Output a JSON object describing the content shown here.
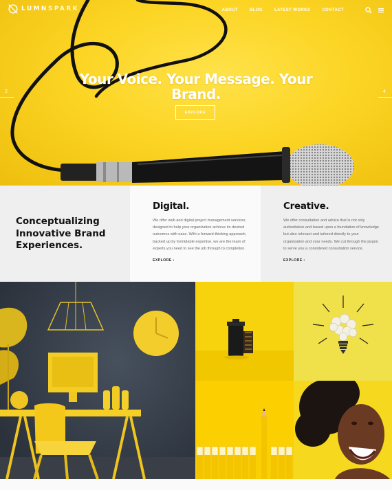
{
  "brand": {
    "logo_part1": "LUMN",
    "logo_part2": "SPARK"
  },
  "nav": {
    "items": [
      "ABOUT",
      "BLOG",
      "LATEST WORKS",
      "CONTACT"
    ]
  },
  "hero": {
    "title": "Your Voice. Your Message. Your Brand.",
    "button": "EXPLORE",
    "prev_slide": "2",
    "next_slide": "4"
  },
  "intro": {
    "tagline": "Conceptualizing Innovative Brand Experiences."
  },
  "services": [
    {
      "title": "Digital.",
      "text": "We offer web and digital project management services, designed to help your organization achieve its desired outcomes with ease. With a forward-thinking approach, backed up by formidable expertise, we are the team of experts you need to see the job through to completion.",
      "link": "EXPLORE ›"
    },
    {
      "title": "Creative.",
      "text": "We offer consultation and advice that is not only authoritative and based upon a foundation of knowledge but also relevant and tailored directly to your organization and your needs. We cut through the jargon to serve you a considered consultation service.",
      "link": "EXPLORE ›"
    }
  ],
  "colors": {
    "accent": "#fcd524",
    "dark": "#111111",
    "grey_bg": "#efefef"
  },
  "icons": {
    "search": "search-icon",
    "menu": "hamburger-menu-icon"
  }
}
